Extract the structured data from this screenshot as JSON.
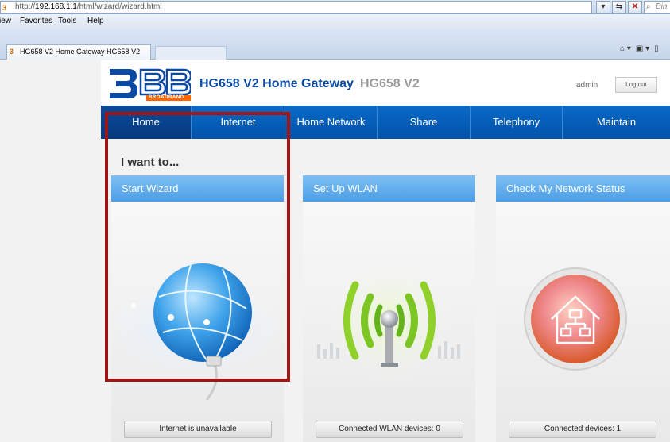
{
  "browser": {
    "url_prefix": "http://",
    "url_host": "192.168.1.1",
    "url_path": "/html/wizard/wizard.html",
    "search_placeholder": "Bin",
    "menu": [
      "iew",
      "Favorites",
      "Tools",
      "Help"
    ],
    "tab_title": "HG658 V2 Home Gateway HG658 V2"
  },
  "header": {
    "logo_text": "3BB",
    "logo_brand": "BROADBAND",
    "product": "HG658 V2 Home Gateway",
    "model": "HG658 V2",
    "user": "admin",
    "logout": "Log out"
  },
  "nav": [
    {
      "label": "Home",
      "active": true
    },
    {
      "label": "Internet",
      "active": false
    },
    {
      "label": "Home Network",
      "active": false
    },
    {
      "label": "Share",
      "active": false
    },
    {
      "label": "Telephony",
      "active": false
    },
    {
      "label": "Maintain",
      "active": false
    }
  ],
  "main": {
    "heading": "I want to...",
    "cards": [
      {
        "title": "Start Wizard",
        "status": "Internet is unavailable",
        "icon": "globe-icon",
        "selected": true
      },
      {
        "title": "Set Up WLAN",
        "status": "Connected WLAN devices: 0",
        "icon": "wifi-antenna-icon",
        "selected": false
      },
      {
        "title": "Check My Network Status",
        "status": "Connected devices: 1",
        "icon": "home-network-icon",
        "selected": false
      }
    ]
  },
  "colors": {
    "brand_blue": "#0a4aa3",
    "nav_blue": "#0a6ac8",
    "card_header": "#4c9de6",
    "selection_border": "#a31515"
  }
}
